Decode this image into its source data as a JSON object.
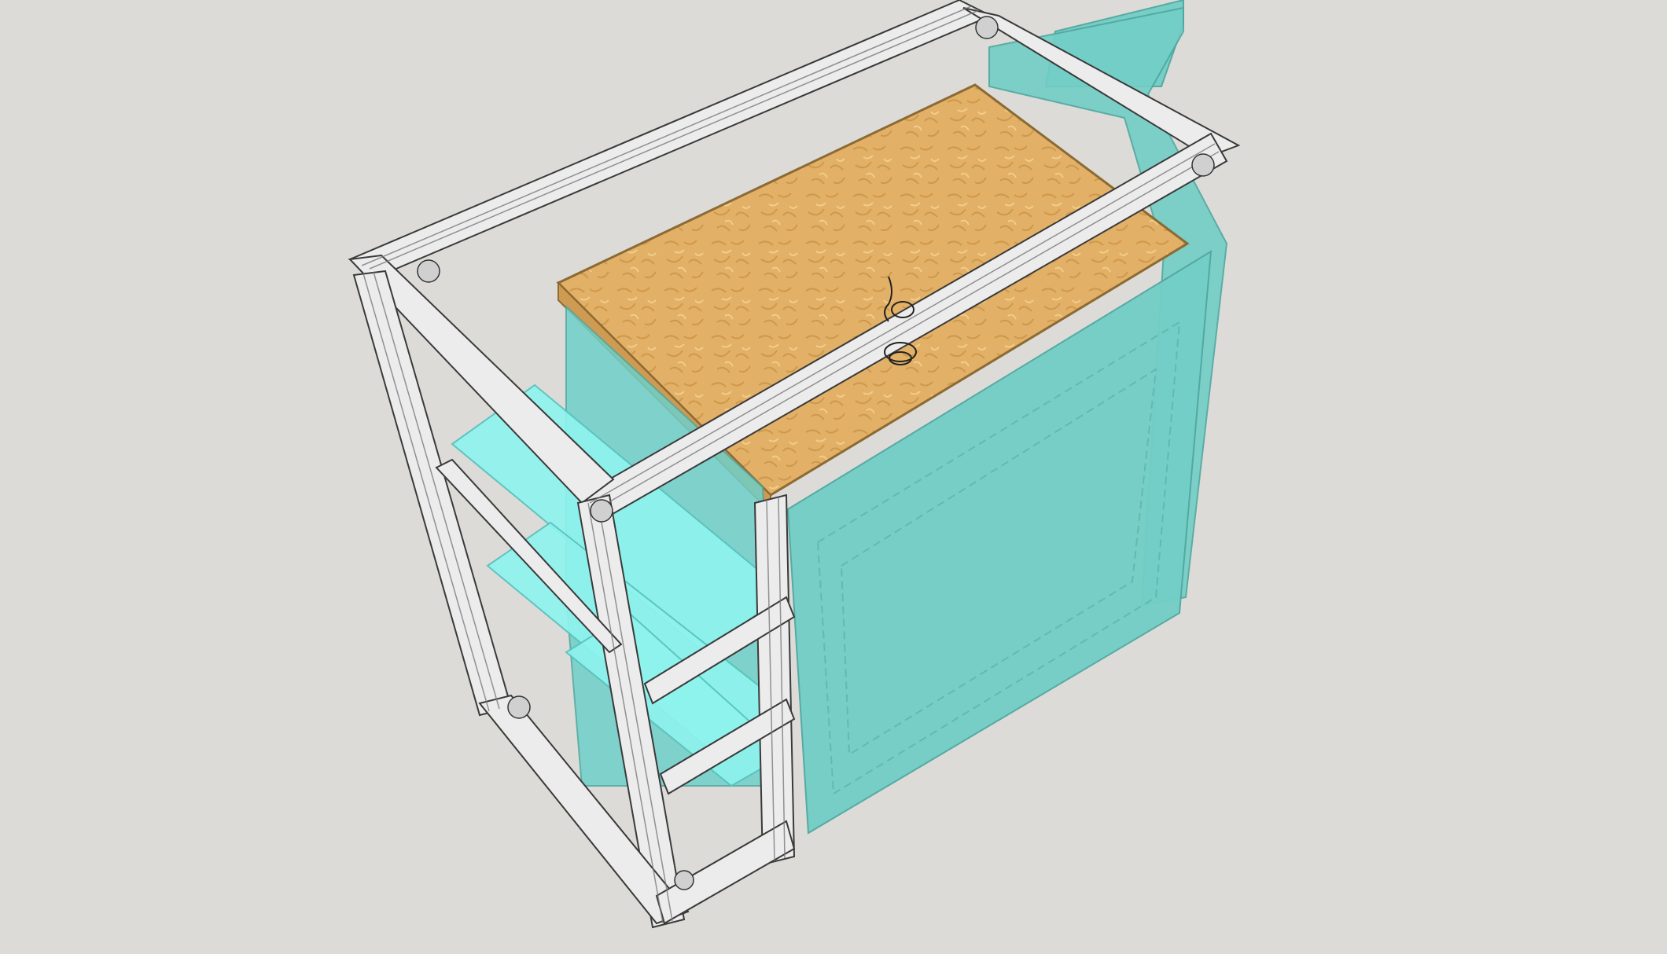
{
  "viewport": {
    "background_color": "#dcdbd7",
    "model": {
      "frame": {
        "material": "aluminum-extrusion",
        "color": "#e6e6e6"
      },
      "board": {
        "material": "osb-plywood",
        "color": "#e2b066"
      },
      "panels": {
        "material": "acrylic",
        "color": "#72cec6"
      },
      "shelves": {
        "material": "acrylic",
        "color": "#8ff3ee"
      }
    }
  }
}
